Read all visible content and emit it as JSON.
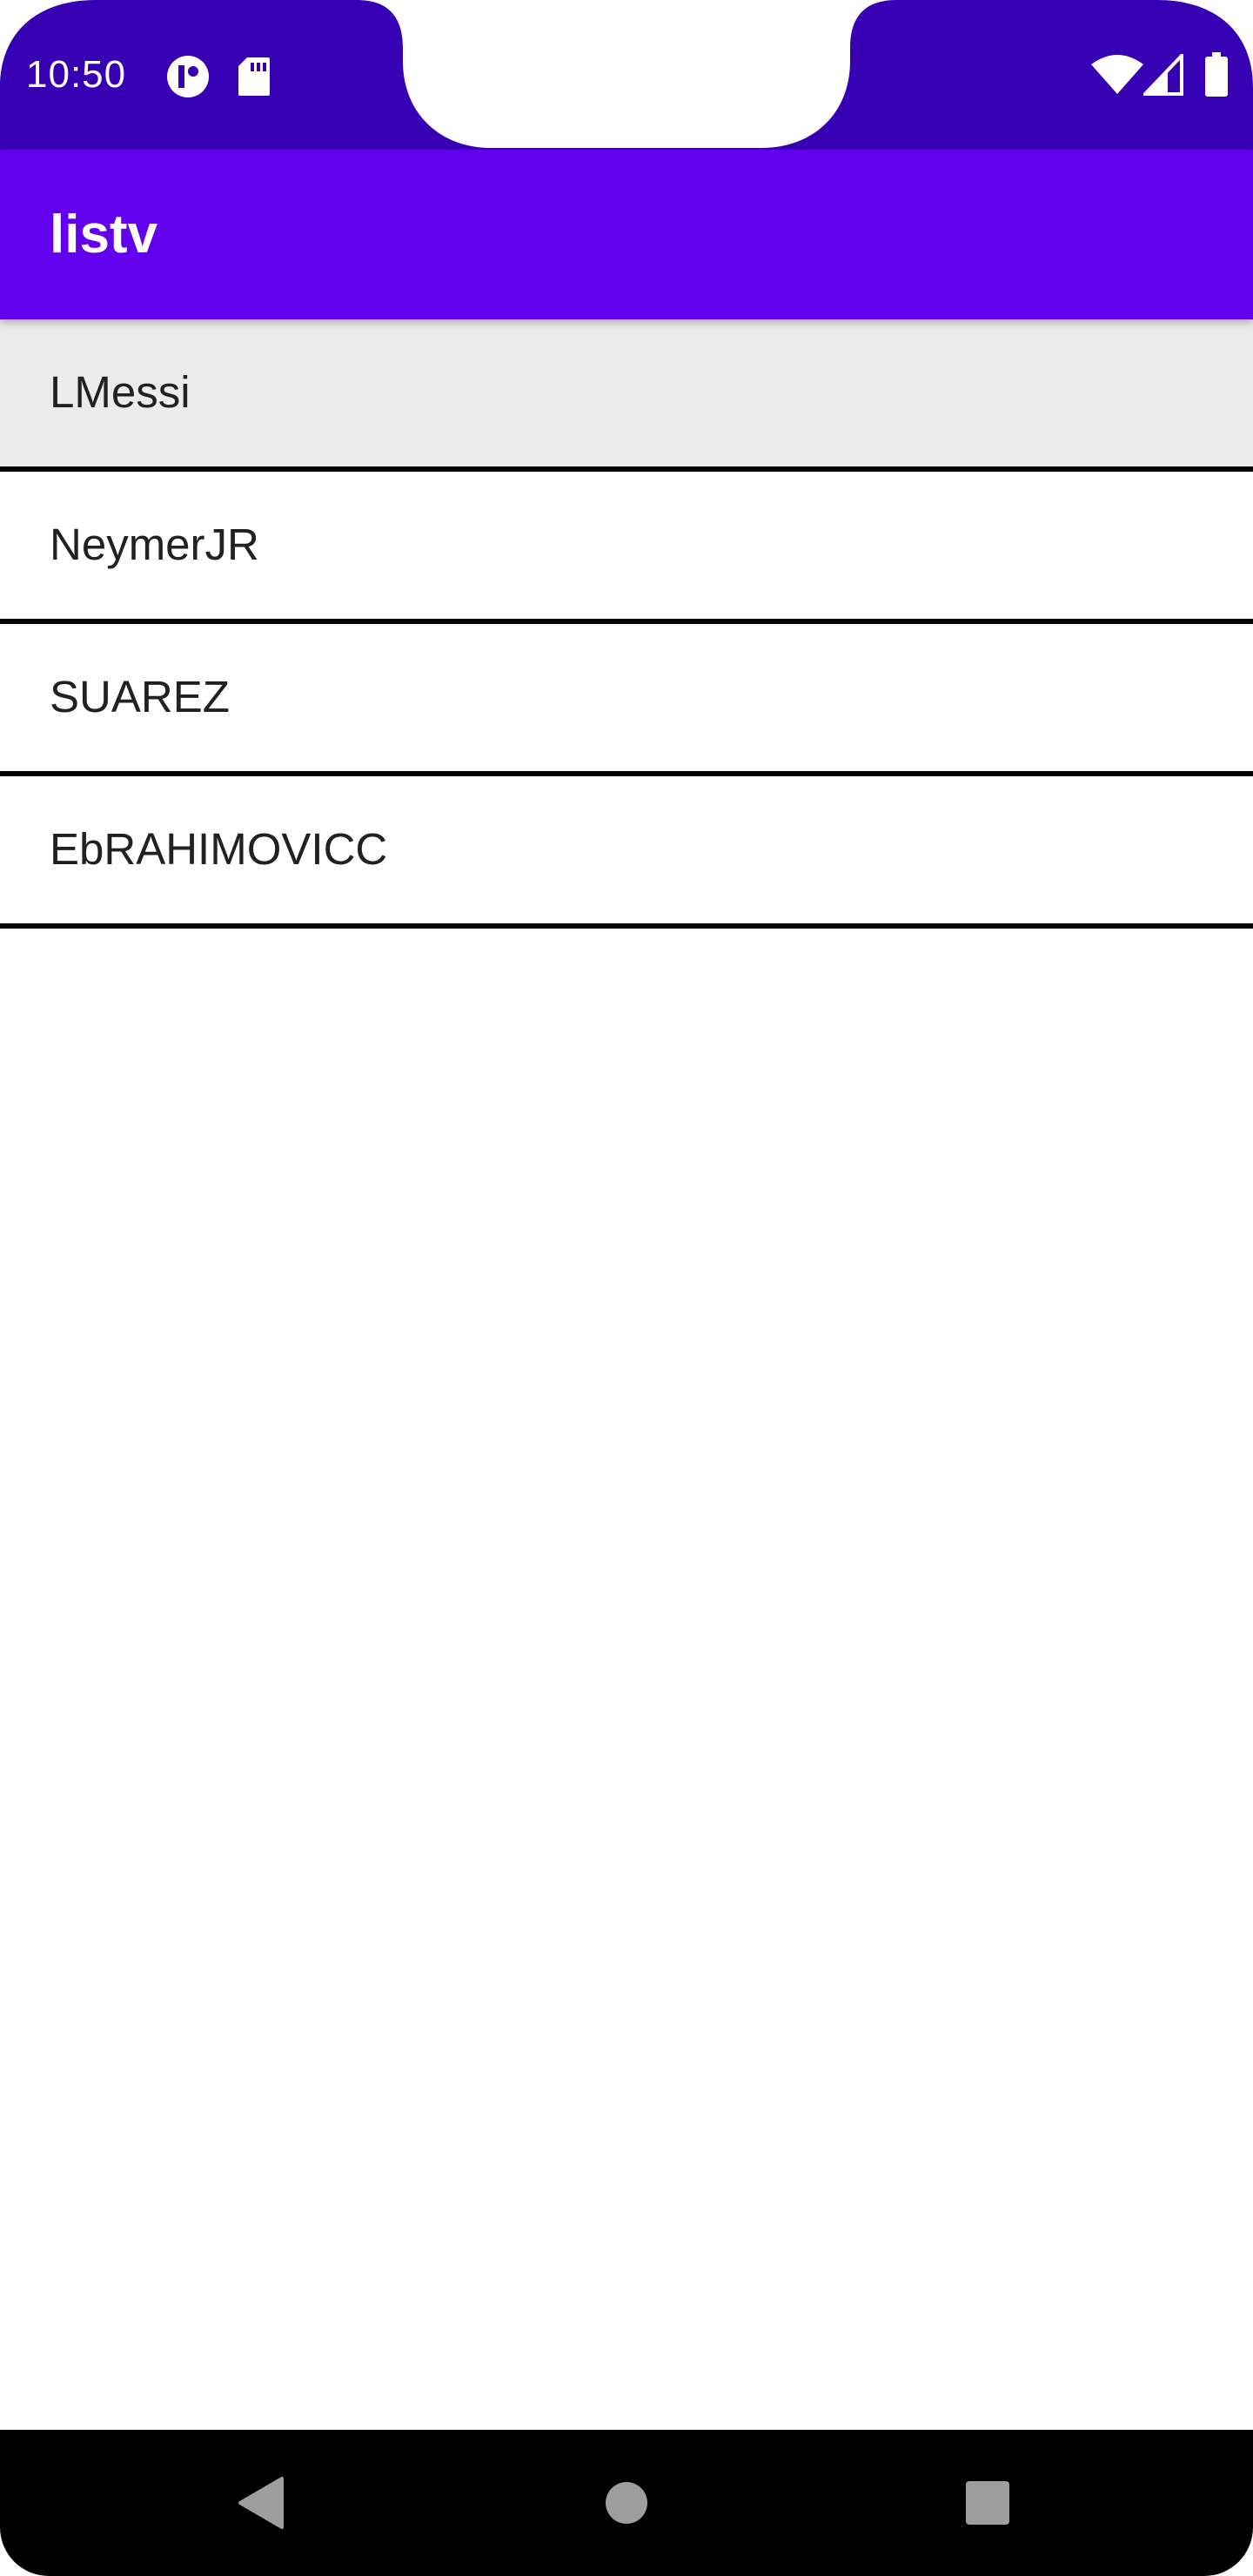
{
  "status_bar": {
    "time": "10:50",
    "background_color": "#3700b3",
    "left_icons": [
      "notification-app-icon",
      "sd-card-icon"
    ],
    "right_icons": [
      "wifi-icon",
      "cell-signal-icon",
      "battery-icon"
    ]
  },
  "app_bar": {
    "title": "listv",
    "background_color": "#6200ee"
  },
  "list": {
    "items": [
      {
        "label": "LMessi",
        "selected": true
      },
      {
        "label": "NeymerJR",
        "selected": false
      },
      {
        "label": "SUAREZ",
        "selected": false
      },
      {
        "label": "EbRAHIMOVICC",
        "selected": false
      }
    ]
  },
  "nav_bar": {
    "buttons": [
      "back-icon",
      "home-icon",
      "recents-icon"
    ]
  }
}
